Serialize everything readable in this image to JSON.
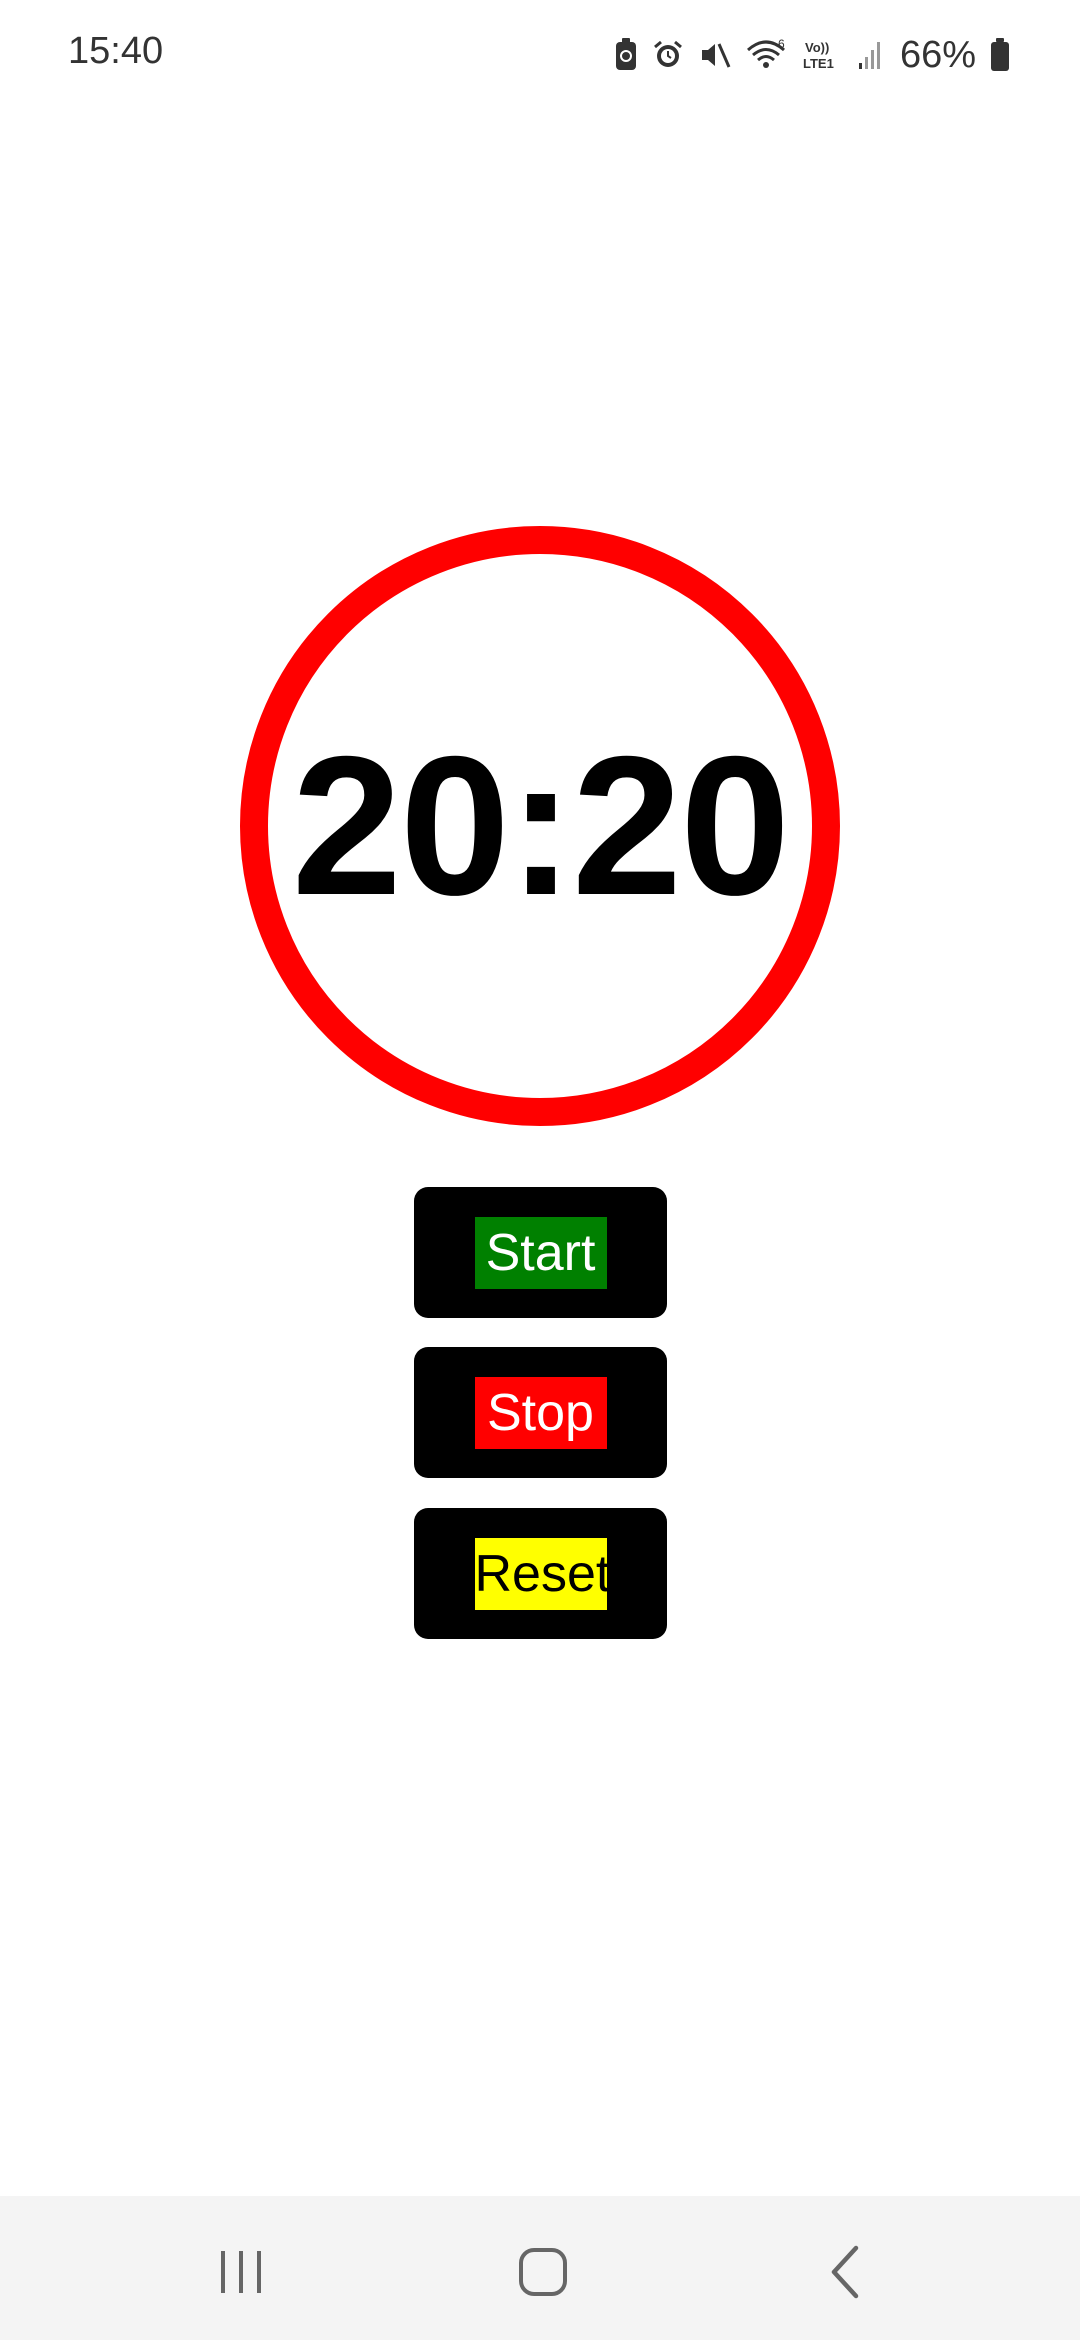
{
  "status_bar": {
    "time": "15:40",
    "battery_percent": "66%",
    "icons": [
      "battery-saver-icon",
      "alarm-icon",
      "mute-icon",
      "wifi-icon",
      "volte-lte-icon",
      "signal-icon",
      "battery-icon"
    ]
  },
  "timer": {
    "display": "20:20",
    "ring_color": "#ff0000"
  },
  "buttons": {
    "start": {
      "label": "Start",
      "bg": "#008000",
      "fg": "#ffffff"
    },
    "stop": {
      "label": "Stop",
      "bg": "#ff0000",
      "fg": "#ffffff"
    },
    "reset": {
      "label": "Reset",
      "bg": "#ffff00",
      "fg": "#000000"
    }
  },
  "nav_bar": {
    "icons": [
      "recents-icon",
      "home-icon",
      "back-icon"
    ]
  }
}
